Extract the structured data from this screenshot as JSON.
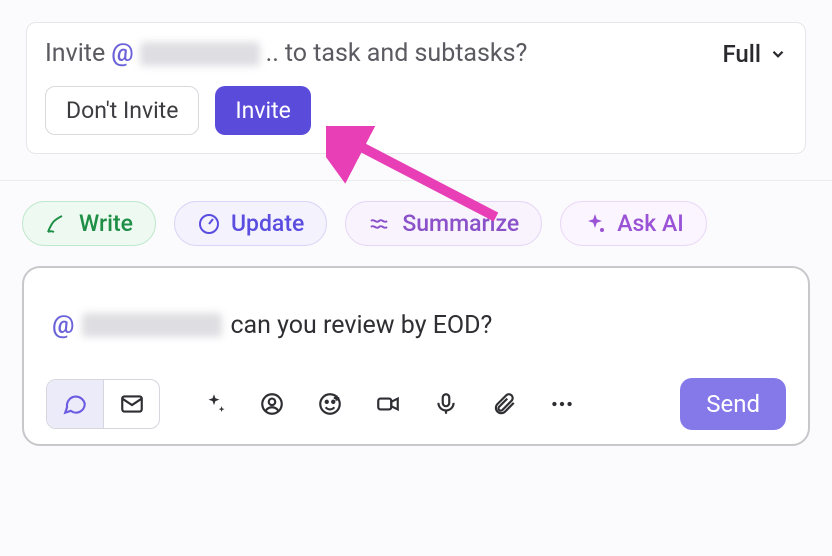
{
  "invite": {
    "prefix": "Invite",
    "at": "@",
    "ellipsis": "..",
    "suffix": "to task and subtasks?",
    "scope_label": "Full",
    "dont_invite_label": "Don't Invite",
    "invite_label": "Invite"
  },
  "chips": {
    "write": "Write",
    "update": "Update",
    "summarize": "Summarize",
    "ask_ai": "Ask AI"
  },
  "composer": {
    "at": "@",
    "message": "can you review by EOD?",
    "send_label": "Send"
  }
}
